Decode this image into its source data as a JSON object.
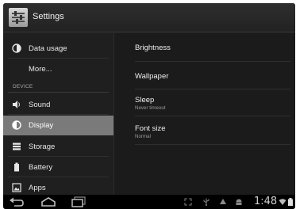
{
  "app": {
    "title": "Settings"
  },
  "sidebar": {
    "items_top": [
      {
        "label": "Data usage",
        "icon": "data-usage-icon"
      },
      {
        "label": "More...",
        "icon": ""
      }
    ],
    "section_header": "DEVICE",
    "items_device": [
      {
        "label": "Sound",
        "icon": "speaker-icon"
      },
      {
        "label": "Display",
        "icon": "display-icon",
        "selected": true
      },
      {
        "label": "Storage",
        "icon": "storage-icon"
      },
      {
        "label": "Battery",
        "icon": "battery-icon"
      },
      {
        "label": "Apps",
        "icon": "apps-icon"
      }
    ]
  },
  "display_settings": [
    {
      "title": "Brightness",
      "subtitle": ""
    },
    {
      "title": "Wallpaper",
      "subtitle": ""
    },
    {
      "title": "Sleep",
      "subtitle": "Never timeout"
    },
    {
      "title": "Font size",
      "subtitle": "Normal"
    }
  ],
  "statusbar": {
    "time": "1:48",
    "icons": [
      "fullscreen-icon",
      "usb-icon",
      "debug-icon",
      "android-icon",
      "wifi-icon",
      "battery-status-icon"
    ]
  },
  "colors": {
    "selected_row": "#7a7a7a",
    "background": "#1c1c1c"
  }
}
